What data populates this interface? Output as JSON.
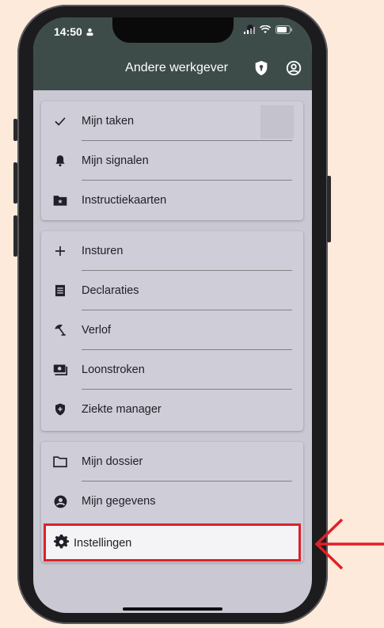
{
  "status": {
    "time": "14:50"
  },
  "header": {
    "title": "Andere werkgever"
  },
  "groups": [
    {
      "items": [
        {
          "label": "Mijn taken",
          "icon": "check-icon"
        },
        {
          "label": "Mijn signalen",
          "icon": "bell-icon"
        },
        {
          "label": "Instructiekaarten",
          "icon": "folder-star-icon"
        }
      ]
    },
    {
      "items": [
        {
          "label": "Insturen",
          "icon": "plus-icon"
        },
        {
          "label": "Declaraties",
          "icon": "receipt-icon"
        },
        {
          "label": "Verlof",
          "icon": "beach-umbrella-icon"
        },
        {
          "label": "Loonstroken",
          "icon": "payslip-icon"
        },
        {
          "label": "Ziekte manager",
          "icon": "shield-plus-icon"
        }
      ]
    },
    {
      "items": [
        {
          "label": "Mijn dossier",
          "icon": "folder-icon"
        },
        {
          "label": "Mijn gegevens",
          "icon": "account-circle-icon"
        },
        {
          "label": "Instellingen",
          "icon": "gear-icon"
        }
      ]
    }
  ],
  "colors": {
    "header": "#3d4c49",
    "highlight_border": "#d9232a",
    "background": "#fdeadb"
  }
}
